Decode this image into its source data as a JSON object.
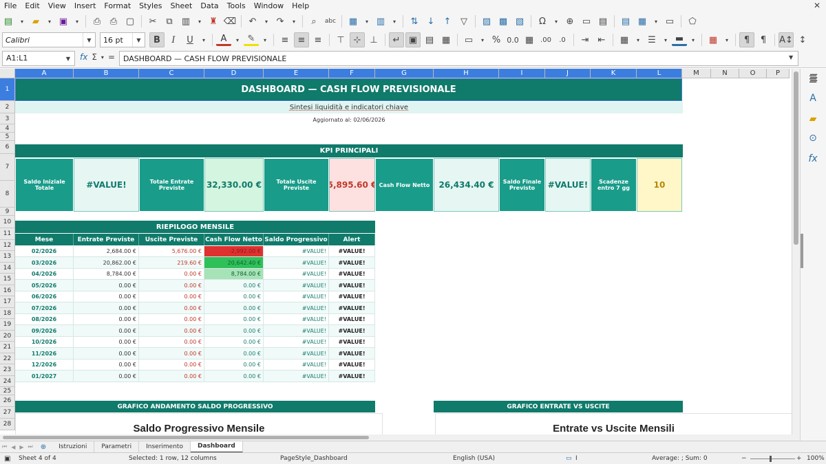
{
  "menu": [
    "File",
    "Edit",
    "View",
    "Insert",
    "Format",
    "Styles",
    "Sheet",
    "Data",
    "Tools",
    "Window",
    "Help"
  ],
  "toolbar": {
    "font_name": "Calibri",
    "font_size": "16 pt",
    "bold_label": "B",
    "italic_label": "I",
    "underline_label": "U",
    "font_color_label": "A",
    "percent_label": "%",
    "decimal_label": "0.0",
    "add_decimal_label": ".00",
    "remove_decimal_label": ".0"
  },
  "formula_bar": {
    "name_box": "A1:L1",
    "formula": "DASHBOARD — CASH FLOW PREVISIONALE"
  },
  "columns": [
    "A",
    "B",
    "C",
    "D",
    "E",
    "F",
    "G",
    "H",
    "I",
    "J",
    "K",
    "L",
    "M",
    "N",
    "O",
    "P"
  ],
  "rows": [
    "1",
    "2",
    "3",
    "4",
    "5",
    "6",
    "7",
    "8",
    "9",
    "10",
    "11",
    "12",
    "13",
    "14",
    "15",
    "16",
    "17",
    "18",
    "19",
    "20",
    "21",
    "22",
    "23",
    "24",
    "25",
    "26",
    "27",
    "28"
  ],
  "sheet": {
    "title": "DASHBOARD — CASH FLOW PREVISIONALE",
    "subtitle": "Sintesi liquidità e indicatori chiave",
    "updated": "Aggiornato al: 02/06/2026",
    "kpi_header": "KPI PRINCIPALI",
    "kpis": [
      {
        "label": "Saldo Iniziale Totale",
        "value": "#VALUE!"
      },
      {
        "label": "Totale Entrate Previste",
        "value": "32,330.00 €"
      },
      {
        "label": "Totale Uscite Previste",
        "value": "5,895.60 €"
      },
      {
        "label": "Cash Flow Netto",
        "value": "26,434.40 €"
      },
      {
        "label": "Saldo Finale Previsto",
        "value": "#VALUE!"
      },
      {
        "label": "Scadenze entro 7 gg",
        "value": "10"
      }
    ],
    "summary_header": "RIEPILOGO MENSILE",
    "summary_columns": [
      "Mese",
      "Entrate Previste",
      "Uscite Previste",
      "Cash Flow Netto",
      "Saldo Progressivo",
      "Alert"
    ],
    "summary_rows": [
      [
        "02/2026",
        "2,684.00 €",
        "5,676.00 €",
        "-2,992.00 €",
        "#VALUE!",
        "#VALUE!"
      ],
      [
        "03/2026",
        "20,862.00 €",
        "219.60 €",
        "20,642.40 €",
        "#VALUE!",
        "#VALUE!"
      ],
      [
        "04/2026",
        "8,784.00 €",
        "0.00 €",
        "8,784.00 €",
        "#VALUE!",
        "#VALUE!"
      ],
      [
        "05/2026",
        "0.00 €",
        "0.00 €",
        "0.00 €",
        "#VALUE!",
        "#VALUE!"
      ],
      [
        "06/2026",
        "0.00 €",
        "0.00 €",
        "0.00 €",
        "#VALUE!",
        "#VALUE!"
      ],
      [
        "07/2026",
        "0.00 €",
        "0.00 €",
        "0.00 €",
        "#VALUE!",
        "#VALUE!"
      ],
      [
        "08/2026",
        "0.00 €",
        "0.00 €",
        "0.00 €",
        "#VALUE!",
        "#VALUE!"
      ],
      [
        "09/2026",
        "0.00 €",
        "0.00 €",
        "0.00 €",
        "#VALUE!",
        "#VALUE!"
      ],
      [
        "10/2026",
        "0.00 €",
        "0.00 €",
        "0.00 €",
        "#VALUE!",
        "#VALUE!"
      ],
      [
        "11/2026",
        "0.00 €",
        "0.00 €",
        "0.00 €",
        "#VALUE!",
        "#VALUE!"
      ],
      [
        "12/2026",
        "0.00 €",
        "0.00 €",
        "0.00 €",
        "#VALUE!",
        "#VALUE!"
      ],
      [
        "01/2027",
        "0.00 €",
        "0.00 €",
        "0.00 €",
        "#VALUE!",
        "#VALUE!"
      ]
    ],
    "chart1_header": "GRAFICO ANDAMENTO SALDO PROGRESSIVO",
    "chart1_title": "Saldo Progressivo Mensile",
    "chart2_header": "GRAFICO ENTRATE VS USCITE",
    "chart2_title": "Entrate vs Uscite Mensili"
  },
  "tabs": [
    "Istruzioni",
    "Parametri",
    "Inserimento",
    "Dashboard"
  ],
  "active_tab": "Dashboard",
  "status": {
    "sheet": "Sheet 4 of 4",
    "selection": "Selected: 1 row, 12 columns",
    "page_style": "PageStyle_Dashboard",
    "language": "English (USA)",
    "summary": "Average: ; Sum: 0",
    "zoom": "100%"
  },
  "colors": {
    "teal_dark": "#107a6b",
    "teal": "#1a9c8a",
    "kpi_light": "#e6f6f3",
    "kpi_green": "#d4f5df",
    "kpi_red": "#fde0e0",
    "kpi_yellow": "#fff7c7",
    "cf_red": "#e03131",
    "cf_green": "#2fc05a",
    "cf_lightgreen": "#a6e3b6",
    "selection_blue": "#3c7ee0"
  }
}
